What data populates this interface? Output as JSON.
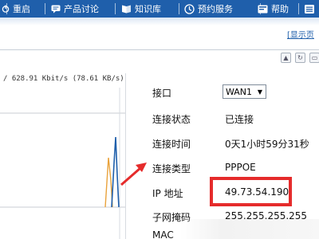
{
  "nav": {
    "items": [
      {
        "label": "重启",
        "icon": "power-icon"
      },
      {
        "label": "产品讨论",
        "icon": "chat-icon"
      },
      {
        "label": "知识库",
        "icon": "book-icon"
      },
      {
        "label": "预约服务",
        "icon": "clock-icon"
      },
      {
        "label": "帮助",
        "icon": "help-icon"
      }
    ]
  },
  "show_link": "[显示页",
  "traffic": {
    "rate_text": "/ 628.91 Kbit/s (78.61 KB/s)"
  },
  "status": {
    "interface_label": "接口",
    "interface_value": "WAN1",
    "conn_status_label": "连接状态",
    "conn_status_value": "已连接",
    "conn_time_label": "连接时间",
    "conn_time_value": "0天1小时59分31秒",
    "conn_type_label": "连接类型",
    "conn_type_value": "PPPOE",
    "ip_label": "IP 地址",
    "ip_value": "49.73.54.190",
    "mask_label": "子网掩码",
    "mask_value": "255.255.255.255",
    "mac_label": "MAC"
  },
  "colors": {
    "nav_bg": "#1f5fab",
    "highlight": "#e52b2b",
    "graph_line": "#1f5fab",
    "graph_line2": "#e9a23b"
  }
}
